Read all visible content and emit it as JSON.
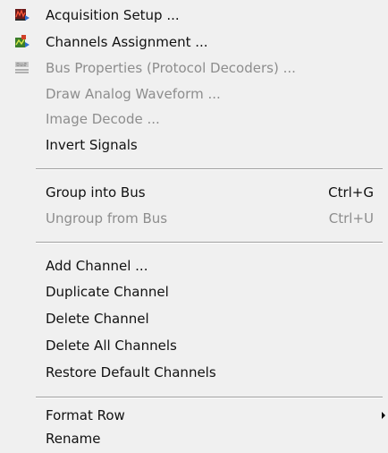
{
  "menu": {
    "items": [
      {
        "label": "Acquisition Setup ...",
        "icon": "acquisition-setup-icon",
        "enabled": true
      },
      {
        "label": "Channels Assignment ...",
        "icon": "channels-assignment-icon",
        "enabled": true
      },
      {
        "label": "Bus Properties (Protocol Decoders) ...",
        "icon": "bus-icon",
        "enabled": false
      },
      {
        "label": "Draw Analog Waveform ...",
        "enabled": false
      },
      {
        "label": "Image Decode ...",
        "enabled": false
      },
      {
        "label": "Invert Signals",
        "enabled": true
      },
      {
        "label": "Group into Bus",
        "shortcut": "Ctrl+G",
        "enabled": true
      },
      {
        "label": "Ungroup from Bus",
        "shortcut": "Ctrl+U",
        "enabled": false
      },
      {
        "label": "Add Channel ...",
        "enabled": true
      },
      {
        "label": "Duplicate Channel",
        "enabled": true
      },
      {
        "label": "Delete Channel",
        "enabled": true
      },
      {
        "label": "Delete All Channels",
        "enabled": true
      },
      {
        "label": "Restore Default Channels",
        "enabled": true
      },
      {
        "label": "Format Row",
        "enabled": true,
        "submenu": true
      },
      {
        "label": "Rename",
        "enabled": true
      }
    ]
  },
  "colors": {
    "background": "#f0f0f0",
    "text": "#111111",
    "disabled_text": "#8d8d8d"
  }
}
